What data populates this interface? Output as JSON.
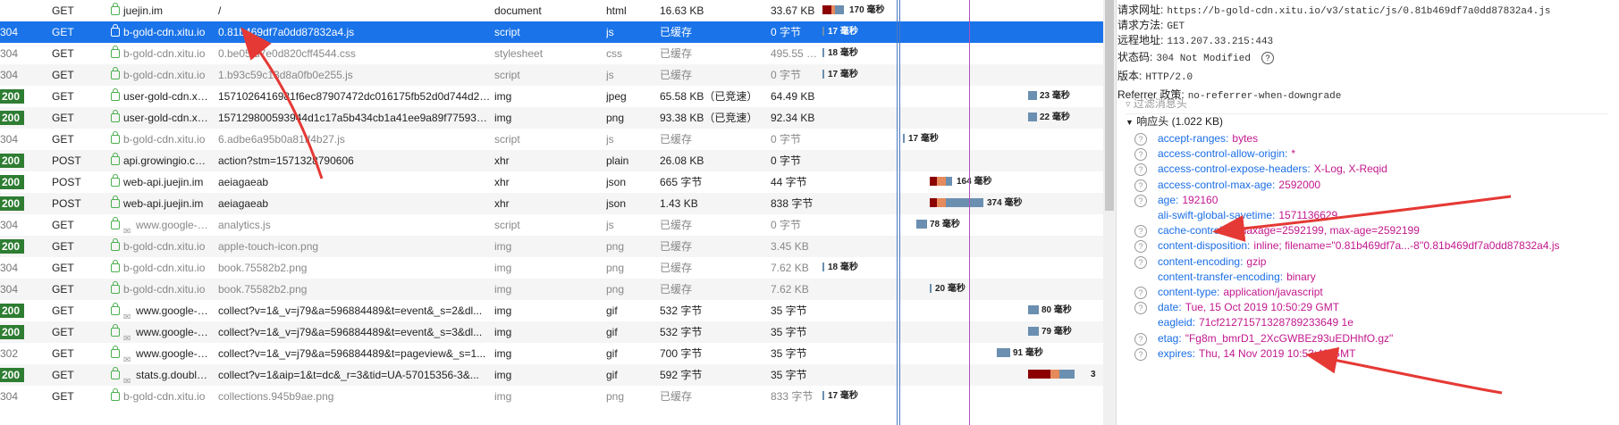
{
  "rows": [
    {
      "status": "",
      "method": "GET",
      "domain": "juejin.im",
      "file": "/",
      "cause": "document",
      "type": "html",
      "transferred": "16.63 KB",
      "size": "33.67 KB",
      "timing": "170 毫秒",
      "cached": false,
      "lock": true,
      "tracker": false
    },
    {
      "status": "304",
      "method": "GET",
      "domain": "b-gold-cdn.xitu.io",
      "file": "0.81b469df7a0dd87832a4.js",
      "cause": "script",
      "type": "js",
      "transferred": "已缓存",
      "size": "0 字节",
      "timing": "17 毫秒",
      "cached": true,
      "lock": true,
      "tracker": false,
      "selected": true
    },
    {
      "status": "304",
      "method": "GET",
      "domain": "b-gold-cdn.xitu.io",
      "file": "0.be05fd7e0d820cff4544.css",
      "cause": "stylesheet",
      "type": "css",
      "transferred": "已缓存",
      "size": "495.55 KB",
      "timing": "18 毫秒",
      "cached": true,
      "lock": true,
      "tracker": false
    },
    {
      "status": "304",
      "method": "GET",
      "domain": "b-gold-cdn.xitu.io",
      "file": "1.b93c59c13d8a0fb0e255.js",
      "cause": "script",
      "type": "js",
      "transferred": "已缓存",
      "size": "0 字节",
      "timing": "17 毫秒",
      "cached": true,
      "lock": true,
      "tracker": false
    },
    {
      "status": "200",
      "method": "GET",
      "domain": "user-gold-cdn.xit...",
      "file": "1571026416981f6ec87907472dc016175fb52d0d744d2.j...",
      "cause": "img",
      "type": "jpeg",
      "transferred": "65.58 KB（已竞速）",
      "size": "64.49 KB",
      "timing": "23 毫秒",
      "cached": false,
      "lock": true,
      "tracker": false
    },
    {
      "status": "200",
      "method": "GET",
      "domain": "user-gold-cdn.xit...",
      "file": "157129800593944d1c17a5b434cb1a41ee9a89f775934f.jp...",
      "cause": "img",
      "type": "png",
      "transferred": "93.38 KB（已竞速）",
      "size": "92.34 KB",
      "timing": "22 毫秒",
      "cached": false,
      "lock": true,
      "tracker": false
    },
    {
      "status": "304",
      "method": "GET",
      "domain": "b-gold-cdn.xitu.io",
      "file": "6.adbe6a95b0a81ff4b27.js",
      "cause": "script",
      "type": "js",
      "transferred": "已缓存",
      "size": "0 字节",
      "timing": "17 毫秒",
      "cached": true,
      "lock": true,
      "tracker": false
    },
    {
      "status": "200",
      "method": "POST",
      "domain": "api.growingio.com",
      "file": "action?stm=1571328790606",
      "cause": "xhr",
      "type": "plain",
      "transferred": "26.08 KB",
      "size": "0 字节",
      "timing": "",
      "cached": false,
      "lock": true,
      "tracker": false
    },
    {
      "status": "200",
      "method": "POST",
      "domain": "web-api.juejin.im",
      "file": "aeiagaeab",
      "cause": "xhr",
      "type": "json",
      "transferred": "665 字节",
      "size": "44 字节",
      "timing": "164 毫秒",
      "cached": false,
      "lock": true,
      "tracker": false
    },
    {
      "status": "200",
      "method": "POST",
      "domain": "web-api.juejin.im",
      "file": "aeiagaeab",
      "cause": "xhr",
      "type": "json",
      "transferred": "1.43 KB",
      "size": "838 字节",
      "timing": "374 毫秒",
      "cached": false,
      "lock": true,
      "tracker": false
    },
    {
      "status": "304",
      "method": "GET",
      "domain": "www.google-a...",
      "file": "analytics.js",
      "cause": "script",
      "type": "js",
      "transferred": "已缓存",
      "size": "0 字节",
      "timing": "78 毫秒",
      "cached": true,
      "lock": true,
      "tracker": true
    },
    {
      "status": "200",
      "method": "GET",
      "domain": "b-gold-cdn.xitu.io",
      "file": "apple-touch-icon.png",
      "cause": "img",
      "type": "png",
      "transferred": "已缓存",
      "size": "3.45 KB",
      "timing": "",
      "cached": true,
      "lock": true,
      "tracker": false
    },
    {
      "status": "304",
      "method": "GET",
      "domain": "b-gold-cdn.xitu.io",
      "file": "book.75582b2.png",
      "cause": "img",
      "type": "png",
      "transferred": "已缓存",
      "size": "7.62 KB",
      "timing": "18 毫秒",
      "cached": true,
      "lock": true,
      "tracker": false
    },
    {
      "status": "304",
      "method": "GET",
      "domain": "b-gold-cdn.xitu.io",
      "file": "book.75582b2.png",
      "cause": "img",
      "type": "png",
      "transferred": "已缓存",
      "size": "7.62 KB",
      "timing": "20 毫秒",
      "cached": true,
      "lock": true,
      "tracker": false
    },
    {
      "status": "200",
      "method": "GET",
      "domain": "www.google-a...",
      "file": "collect?v=1&_v=j79&a=596884489&t=event&_s=2&dl...",
      "cause": "img",
      "type": "gif",
      "transferred": "532 字节",
      "size": "35 字节",
      "timing": "80 毫秒",
      "cached": false,
      "lock": true,
      "tracker": true
    },
    {
      "status": "200",
      "method": "GET",
      "domain": "www.google-a...",
      "file": "collect?v=1&_v=j79&a=596884489&t=event&_s=3&dl...",
      "cause": "img",
      "type": "gif",
      "transferred": "532 字节",
      "size": "35 字节",
      "timing": "79 毫秒",
      "cached": false,
      "lock": true,
      "tracker": true
    },
    {
      "status": "302",
      "method": "GET",
      "domain": "www.google-a...",
      "file": "collect?v=1&_v=j79&a=596884489&t=pageview&_s=1...",
      "cause": "img",
      "type": "gif",
      "transferred": "700 字节",
      "size": "35 字节",
      "timing": "91 毫秒",
      "cached": false,
      "lock": true,
      "tracker": true
    },
    {
      "status": "200",
      "method": "GET",
      "domain": "stats.g.double...",
      "file": "collect?v=1&aip=1&t=dc&_r=3&tid=UA-57015356-3&...",
      "cause": "img",
      "type": "gif",
      "transferred": "592 字节",
      "size": "35 字节",
      "timing": "3",
      "cached": false,
      "lock": true,
      "tracker": true
    },
    {
      "status": "304",
      "method": "GET",
      "domain": "b-gold-cdn.xitu.io",
      "file": "collections.945b9ae.png",
      "cause": "img",
      "type": "png",
      "transferred": "已缓存",
      "size": "833 字节",
      "timing": "17 毫秒",
      "cached": true,
      "lock": true,
      "tracker": false
    }
  ],
  "panel": {
    "top": [
      {
        "k": "请求网址:",
        "v": "https://b-gold-cdn.xitu.io/v3/static/js/0.81b469df7a0dd87832a4.js"
      },
      {
        "k": "请求方法:",
        "v": "GET"
      },
      {
        "k": "远程地址:",
        "v": "113.207.33.215:443"
      },
      {
        "k": "状态码:",
        "v": "304  Not Modified"
      },
      {
        "k": "版本:",
        "v": "HTTP/2.0"
      },
      {
        "k": "Referrer 政策:",
        "v": "no-referrer-when-downgrade"
      }
    ],
    "filter_placeholder": "过滤消息头",
    "section_title": "响应头 (1.022 KB)",
    "headers": [
      {
        "name": "accept-ranges:",
        "value": "bytes",
        "q": true
      },
      {
        "name": "access-control-allow-origin:",
        "value": "*",
        "q": true
      },
      {
        "name": "access-control-expose-headers:",
        "value": "X-Log, X-Reqid",
        "q": true
      },
      {
        "name": "access-control-max-age:",
        "value": "2592000",
        "q": true
      },
      {
        "name": "age:",
        "value": "192160",
        "q": true
      },
      {
        "name": "ali-swift-global-savetime:",
        "value": "1571136629",
        "q": false
      },
      {
        "name": "cache-control:",
        "value": "s-maxage=2592199, max-age=2592199",
        "q": true
      },
      {
        "name": "content-disposition:",
        "value": "inline; filename=\"0.81b469df7a...-8''0.81b469df7a0dd87832a4.js",
        "q": true
      },
      {
        "name": "content-encoding:",
        "value": "gzip",
        "q": true
      },
      {
        "name": "content-transfer-encoding:",
        "value": "binary",
        "q": false
      },
      {
        "name": "content-type:",
        "value": "application/javascript",
        "q": true
      },
      {
        "name": "date:",
        "value": "Tue, 15 Oct 2019 10:50:29 GMT",
        "q": true
      },
      {
        "name": "eagleid:",
        "value": "71cf21271571328789233649 1e",
        "q": false
      },
      {
        "name": "etag:",
        "value": "\"Fg8m_bmrD1_2XcGWBEz93uEDHhfO.gz\"",
        "q": true
      },
      {
        "name": "expires:",
        "value": "Thu, 14 Nov 2019 10:53:48 GMT",
        "q": true
      }
    ]
  },
  "colors": {
    "selected": "#1a73e8",
    "status_ok": "#2e7d32",
    "header_name": "#1a6ee6",
    "header_value": "#c2188d",
    "arrow": "#e53935"
  }
}
